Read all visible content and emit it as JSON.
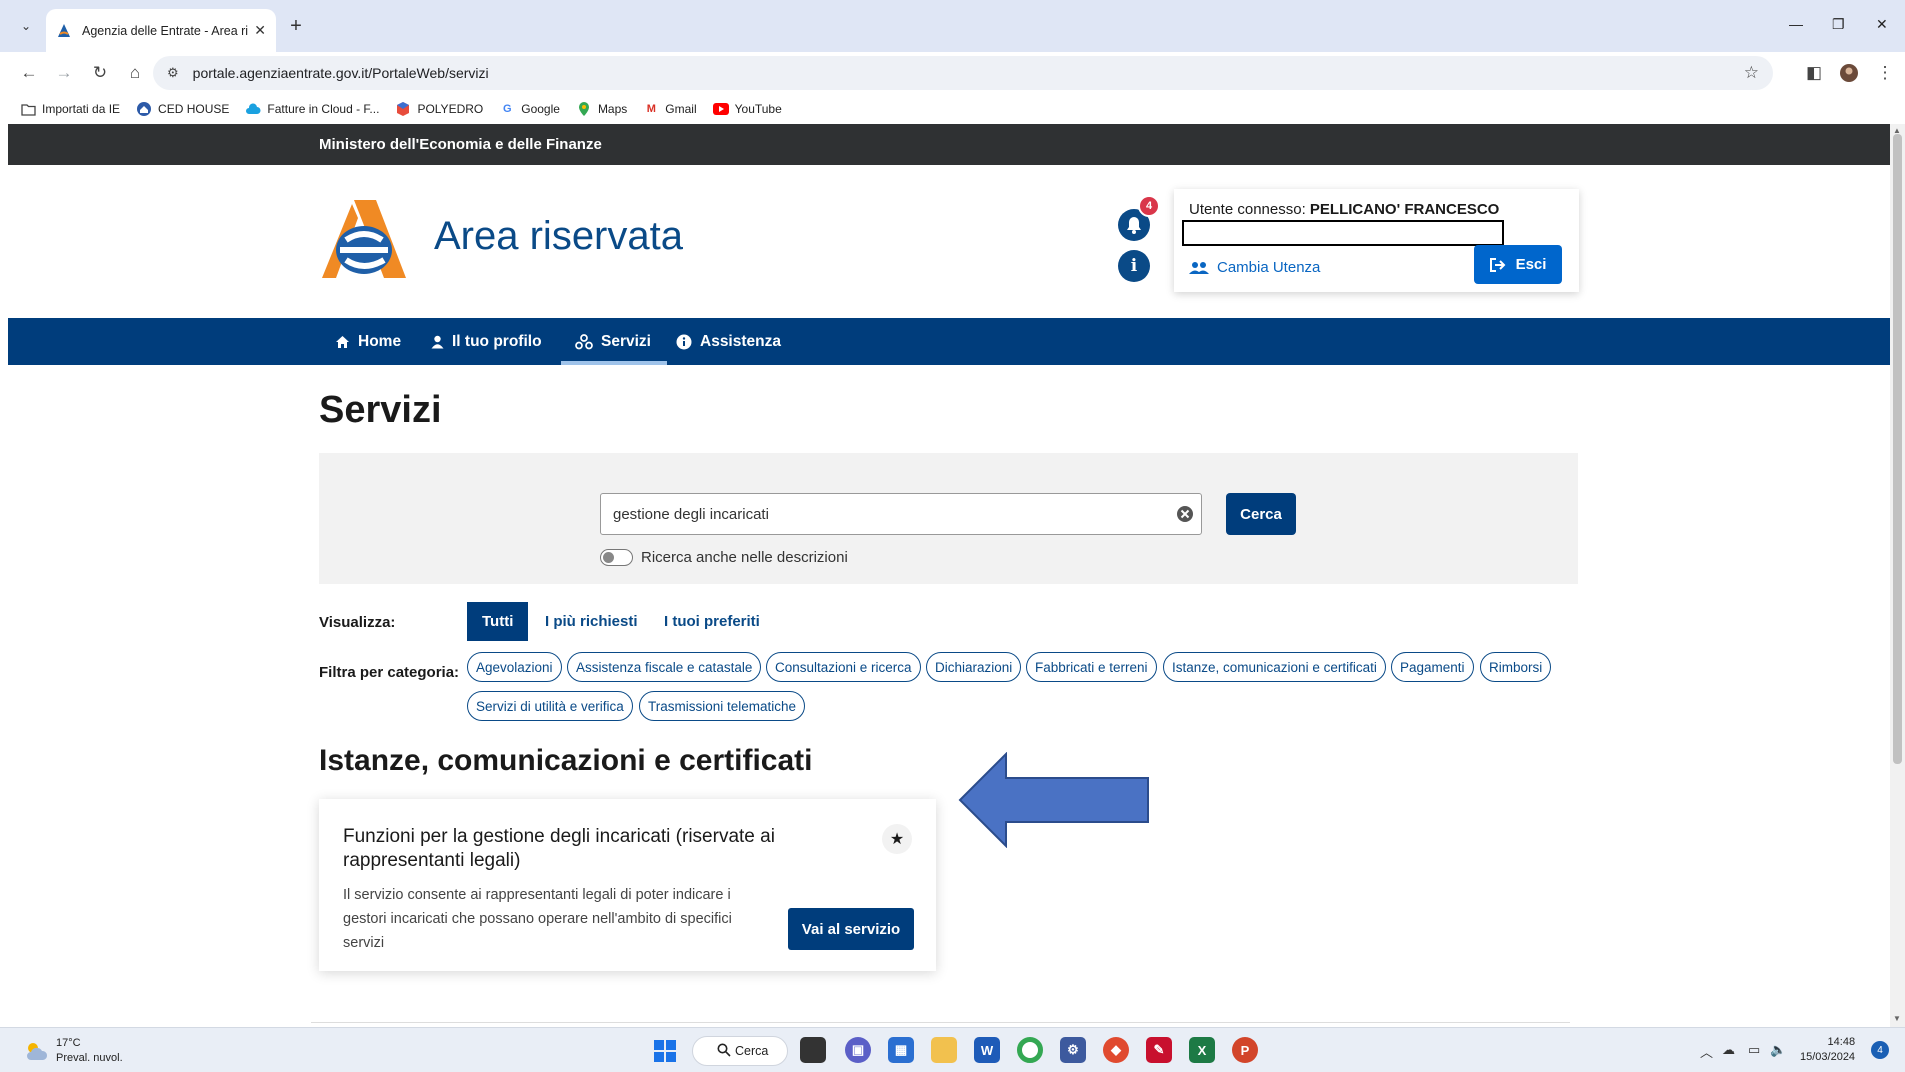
{
  "browser": {
    "tab_title": "Agenzia delle Entrate - Area ris",
    "url": "portale.agenziaentrate.gov.it/PortaleWeb/servizi",
    "bookmarks": [
      {
        "label": "Importati da IE",
        "icon": "folder-icon"
      },
      {
        "label": "CED HOUSE",
        "icon": "ced-house-icon"
      },
      {
        "label": "Fatture in Cloud - F...",
        "icon": "cloud-icon"
      },
      {
        "label": "POLYEDRO",
        "icon": "polyedro-icon"
      },
      {
        "label": "Google",
        "icon": "google-icon"
      },
      {
        "label": "Maps",
        "icon": "maps-pin-icon"
      },
      {
        "label": "Gmail",
        "icon": "gmail-icon"
      },
      {
        "label": "YouTube",
        "icon": "youtube-icon"
      }
    ]
  },
  "site": {
    "ministry_bar": "Ministero dell'Economia e delle Finanze",
    "title": "Area riservata",
    "notification_count": "4",
    "user_label": "Utente connesso:",
    "user_name": "PELLICANO' FRANCESCO",
    "switch_user": "Cambia Utenza",
    "logout": "Esci"
  },
  "nav": {
    "items": [
      {
        "label": "Home",
        "icon": "home-icon"
      },
      {
        "label": "Il tuo profilo",
        "icon": "user-icon"
      },
      {
        "label": "Servizi",
        "icon": "services-icon",
        "active": true
      },
      {
        "label": "Assistenza",
        "icon": "info-circle-icon"
      }
    ]
  },
  "main": {
    "heading": "Servizi",
    "search": {
      "value": "gestione degli incaricati",
      "button": "Cerca",
      "toggle_label": "Ricerca anche nelle descrizioni",
      "toggle_on": false
    },
    "view": {
      "label": "Visualizza:",
      "options": [
        "Tutti",
        "I più richiesti",
        "I tuoi preferiti"
      ],
      "selected": "Tutti"
    },
    "filter": {
      "label": "Filtra per categoria:",
      "categories": [
        "Agevolazioni",
        "Assistenza fiscale e catastale",
        "Consultazioni e ricerca",
        "Dichiarazioni",
        "Fabbricati e terreni",
        "Istanze, comunicazioni e certificati",
        "Pagamenti",
        "Rimborsi",
        "Servizi di utilità e verifica",
        "Trasmissioni telematiche"
      ]
    },
    "section_title": "Istanze, comunicazioni e certificati",
    "card": {
      "title": "Funzioni per la gestione degli incaricati (riservate ai rappresentanti legali)",
      "description": "Il servizio consente ai rappresentanti legali di poter indicare i gestori incaricati che possano operare nell'ambito di specifici servizi",
      "button": "Vai al servizio"
    }
  },
  "colors": {
    "brand_dark_blue": "#003d7c",
    "title_blue": "#0a4a87",
    "link_blue": "#0066cc",
    "ministry_bar": "#2f3133",
    "badge_red": "#d9364a",
    "annotation_arrow": "#4a72c4"
  },
  "taskbar": {
    "weather_temp": "17°C",
    "weather_desc": "Preval. nuvol.",
    "search_label": "Cerca",
    "time": "14:48",
    "date": "15/03/2024",
    "notification_count": "4"
  }
}
